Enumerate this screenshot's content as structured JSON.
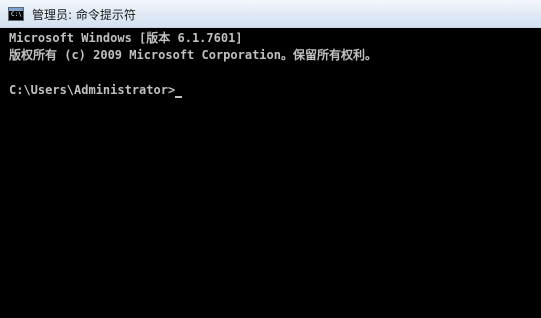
{
  "window": {
    "title": "管理员: 命令提示符",
    "icon": "cmd-icon",
    "icon_label": "C:\\"
  },
  "console": {
    "line1": "Microsoft Windows [版本 6.1.7601]",
    "line2": "版权所有 (c) 2009 Microsoft Corporation。保留所有权利。",
    "prompt": "C:\\Users\\Administrator>"
  },
  "colors": {
    "console_background": "#000000",
    "console_text": "#c0c0c0",
    "titlebar": "#dfe9f5"
  }
}
